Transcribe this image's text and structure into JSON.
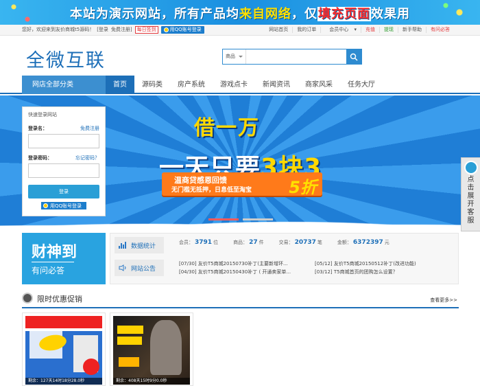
{
  "banner": {
    "text_a": "本站为演示网站，所有产品均",
    "text_b": "来自网络",
    "text_c": "，仅",
    "text_d": "填充页面",
    "text_e": "效果用"
  },
  "topbar": {
    "welcome": "您好，欢迎来到友价商城t5源码！",
    "login": "[登录",
    "register": "免费注册]",
    "signin": "每日签到",
    "qq_login": "用QQ账号登录",
    "links": [
      "网站首页",
      "我的订单",
      "会员中心",
      "充值",
      "提现",
      "新手帮助",
      "有问必答"
    ]
  },
  "logo": "全微互联",
  "search": {
    "select": "商品",
    "placeholder": ""
  },
  "nav": {
    "category": "网店全部分类",
    "items": [
      "首页",
      "源码类",
      "房产系统",
      "游戏点卡",
      "新闻资讯",
      "商家风采",
      "任务大厅"
    ]
  },
  "hero": {
    "line1": "借一万",
    "line2a": "一天只要",
    "line2b": "3块3",
    "promo1": "温商贷感恩回馈",
    "promo2": "无门槛无抵押，日息低至淘宝",
    "promo3": "5折"
  },
  "login": {
    "title": "快速登录网站",
    "username": "登录名：",
    "register": "免费注册",
    "password": "登录密码：",
    "forgot": "忘记密码？",
    "button": "登录",
    "qq": "用QQ账号登录"
  },
  "side_ad": "点击展开客服",
  "stats_box": {
    "title": "财神到",
    "subtitle": "有问必答"
  },
  "stats": {
    "label1": "数据统计",
    "label2": "网站公告",
    "members_label": "会员：",
    "members": "3791",
    "members_unit": "位",
    "products_label": "商品：",
    "products": "27",
    "products_unit": "件",
    "trades_label": "交易：",
    "trades": "20737",
    "trades_unit": "笔",
    "amount_label": "金额：",
    "amount": "6372397",
    "amount_unit": "元",
    "news_left": [
      "[07/30] 友价T5商城20150730补丁(主要新增环...",
      "[04/30] 友价T5商城20150430补丁 ( 开通卖家单..."
    ],
    "news_right": [
      "[05/12] 友价T5商城20150512补丁(改进功能)",
      "[03/12] T5商城首页的团购怎么设置？"
    ]
  },
  "section": {
    "title": "限时优惠促销",
    "more": "查看更多>>"
  },
  "products": [
    {
      "countdown": "剩余：127天14时18分28.0秒"
    },
    {
      "countdown": "剩余：408天15时9分0.0秒"
    }
  ],
  "colors": {
    "primary": "#1d6fb8",
    "accent": "#29a3e0",
    "red": "#e4393c"
  }
}
